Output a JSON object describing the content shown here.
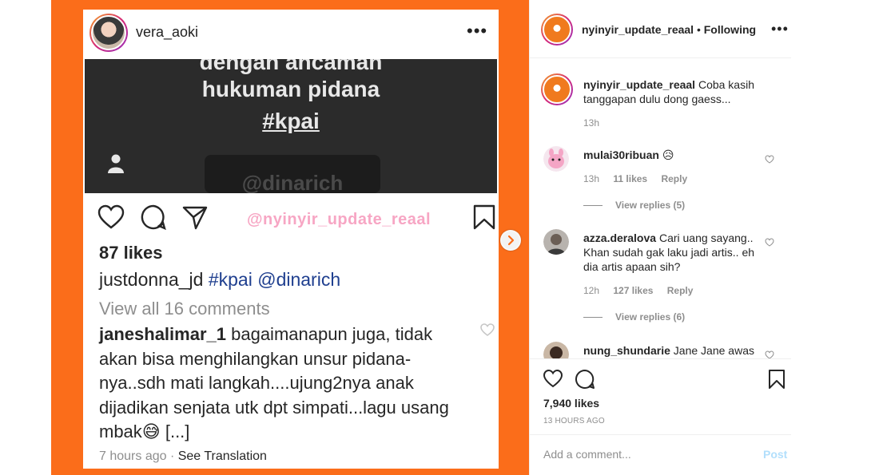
{
  "screenshot": {
    "username": "vera_aoki",
    "menu_dots": "•••",
    "story_lines": [
      "dengan ancaman",
      "hukuman pidana"
    ],
    "story_tag": "#kpai",
    "story_blur_text": "@dinarich",
    "watermark": "@nyinyir_update_reaal",
    "likes": "87 likes",
    "caption_user": "justdonna_jd",
    "caption_tags": "#kpai @dinarich",
    "view_all": "View all 16 comments",
    "comment_user": "janeshalimar_1",
    "comment_text": "bagaimanapun juga, tidak akan bisa menghilangkan unsur pidana-nya..sdh mati langkah....ujung2nya anak dijadikan senjata utk dpt simpati...lagu usang mbak😅 [...]",
    "time": "7 hours ago",
    "see_translation": "See Translation"
  },
  "panel": {
    "header": {
      "username": "nyinyir_update_reaal",
      "separator": "•",
      "following": "Following",
      "menu_dots": "•••"
    },
    "caption": {
      "username": "nyinyir_update_reaal",
      "text": "Coba kasih tanggapan dulu dong gaess...",
      "time": "13h"
    },
    "comments": [
      {
        "username": "mulai30ribuan",
        "text": "😥",
        "time": "13h",
        "likes": "11 likes",
        "reply": "Reply",
        "view_replies": "View replies (5)"
      },
      {
        "username": "azza.deralova",
        "text": "Cari uang sayang.. Khan sudah gak laku jadi artis.. eh dia artis apaan sih?",
        "time": "12h",
        "likes": "127 likes",
        "reply": "Reply",
        "view_replies": "View replies (6)"
      },
      {
        "username": "nung_shundarie",
        "text": "Jane Jane awas"
      }
    ],
    "like_count": "7,940 likes",
    "posted": "13 HOURS AGO",
    "add_comment_placeholder": "Add a comment...",
    "post_label": "Post",
    "colors": {
      "accent": "#fb6d1a",
      "link_disabled": "#b2dffc",
      "muted": "#8e8e8e"
    }
  }
}
